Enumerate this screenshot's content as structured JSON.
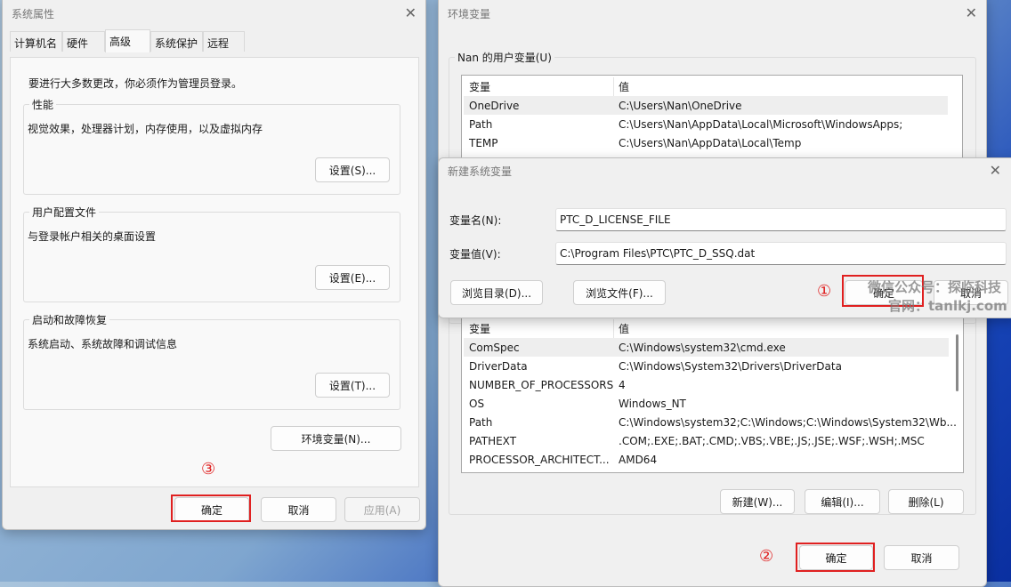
{
  "sys_props": {
    "title": "系统属性",
    "tabs": [
      "计算机名",
      "硬件",
      "高级",
      "系统保护",
      "远程"
    ],
    "notice": "要进行大多数更改，你必须作为管理员登录。",
    "groups": [
      {
        "label": "性能",
        "desc": "视觉效果，处理器计划，内存使用，以及虚拟内存",
        "button": "设置(S)..."
      },
      {
        "label": "用户配置文件",
        "desc": "与登录帐户相关的桌面设置",
        "button": "设置(E)..."
      },
      {
        "label": "启动和故障恢复",
        "desc": "系统启动、系统故障和调试信息",
        "button": "设置(T)..."
      }
    ],
    "env_button": "环境变量(N)...",
    "ok": "确定",
    "cancel": "取消",
    "apply": "应用(A)",
    "step": "③"
  },
  "env_vars": {
    "title": "环境变量",
    "user_group": "Nan 的用户变量(U)",
    "col_var": "变量",
    "col_val": "值",
    "user_rows": [
      {
        "name": "OneDrive",
        "value": "C:\\Users\\Nan\\OneDrive"
      },
      {
        "name": "Path",
        "value": "C:\\Users\\Nan\\AppData\\Local\\Microsoft\\WindowsApps;"
      },
      {
        "name": "TEMP",
        "value": "C:\\Users\\Nan\\AppData\\Local\\Temp"
      }
    ],
    "sys_rows": [
      {
        "name": "ComSpec",
        "value": "C:\\Windows\\system32\\cmd.exe"
      },
      {
        "name": "DriverData",
        "value": "C:\\Windows\\System32\\Drivers\\DriverData"
      },
      {
        "name": "NUMBER_OF_PROCESSORS",
        "value": "4"
      },
      {
        "name": "OS",
        "value": "Windows_NT"
      },
      {
        "name": "Path",
        "value": "C:\\Windows\\system32;C:\\Windows;C:\\Windows\\System32\\Wb..."
      },
      {
        "name": "PATHEXT",
        "value": ".COM;.EXE;.BAT;.CMD;.VBS;.VBE;.JS;.JSE;.WSF;.WSH;.MSC"
      },
      {
        "name": "PROCESSOR_ARCHITECT...",
        "value": "AMD64"
      }
    ],
    "new": "新建(W)...",
    "edit": "编辑(I)...",
    "delete": "删除(L)",
    "ok": "确定",
    "cancel": "取消",
    "step": "②"
  },
  "new_var": {
    "title": "新建系统变量",
    "name_label": "变量名(N):",
    "name_value": "PTC_D_LICENSE_FILE",
    "value_label": "变量值(V):",
    "value_value": "C:\\Program Files\\PTC\\PTC_D_SSQ.dat",
    "browse_dir": "浏览目录(D)...",
    "browse_file": "浏览文件(F)...",
    "ok": "确定",
    "cancel": "取消",
    "step": "①"
  },
  "watermark": {
    "line1": "微信公众号：探临科技",
    "line2": "官网：tanlkj.com"
  }
}
